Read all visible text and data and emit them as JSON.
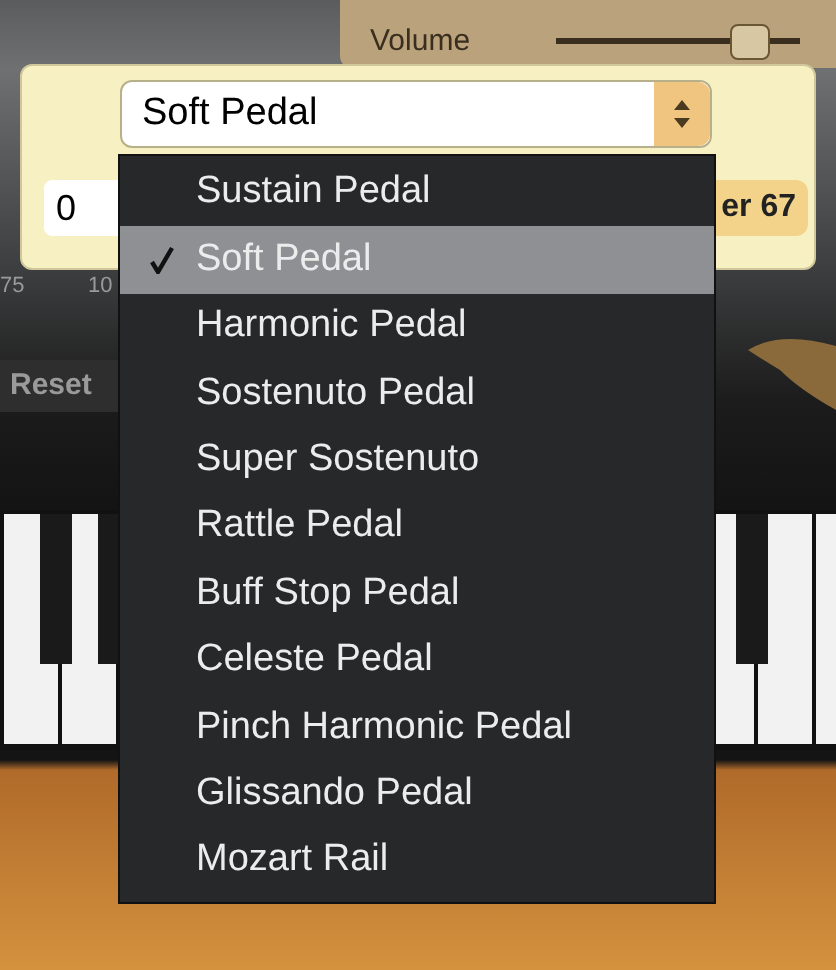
{
  "volume": {
    "label": "Volume",
    "level": 0.85
  },
  "panel": {
    "value_field": "0",
    "dropdown": {
      "value": "Soft Pedal"
    },
    "badge": "er 67"
  },
  "scale_labels": [
    "75",
    "10"
  ],
  "reset_button": "Reset",
  "menu": [
    {
      "label": "Sustain Pedal",
      "selected": false
    },
    {
      "label": "Soft Pedal",
      "selected": true
    },
    {
      "label": "Harmonic Pedal",
      "selected": false
    },
    {
      "label": "Sostenuto Pedal",
      "selected": false
    },
    {
      "label": "Super Sostenuto",
      "selected": false
    },
    {
      "label": "Rattle Pedal",
      "selected": false
    },
    {
      "label": "Buff Stop Pedal",
      "selected": false
    },
    {
      "label": "Celeste Pedal",
      "selected": false
    },
    {
      "label": "Pinch Harmonic Pedal",
      "selected": false
    },
    {
      "label": "Glissando Pedal",
      "selected": false
    },
    {
      "label": "Mozart Rail",
      "selected": false
    }
  ]
}
